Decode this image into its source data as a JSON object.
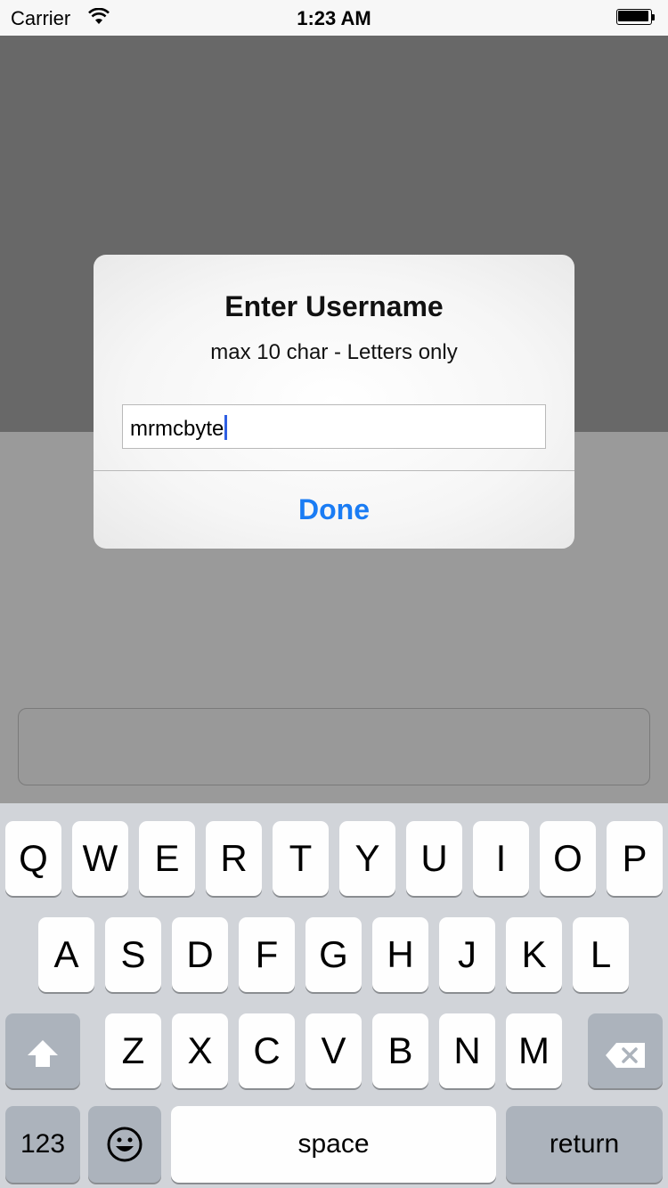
{
  "status_bar": {
    "carrier": "Carrier",
    "time": "1:23 AM",
    "wifi_icon": "wifi-icon",
    "battery_icon": "battery-icon"
  },
  "alert": {
    "title": "Enter Username",
    "message": "max 10 char - Letters only",
    "input_value": "mrmcbyte",
    "button_label": "Done",
    "button_color": "#1a7cf4"
  },
  "keyboard": {
    "row1": [
      "Q",
      "W",
      "E",
      "R",
      "T",
      "Y",
      "U",
      "I",
      "O",
      "P"
    ],
    "row2": [
      "A",
      "S",
      "D",
      "F",
      "G",
      "H",
      "J",
      "K",
      "L"
    ],
    "row3": [
      "Z",
      "X",
      "C",
      "V",
      "B",
      "N",
      "M"
    ],
    "numbers_label": "123",
    "space_label": "space",
    "return_label": "return",
    "shift_icon": "shift-icon",
    "delete_icon": "delete-icon",
    "emoji_icon": "emoji-icon"
  },
  "colors": {
    "keyboard_bg": "#d1d4d9",
    "function_key": "#acb3bc",
    "caret": "#2f5fe3"
  }
}
